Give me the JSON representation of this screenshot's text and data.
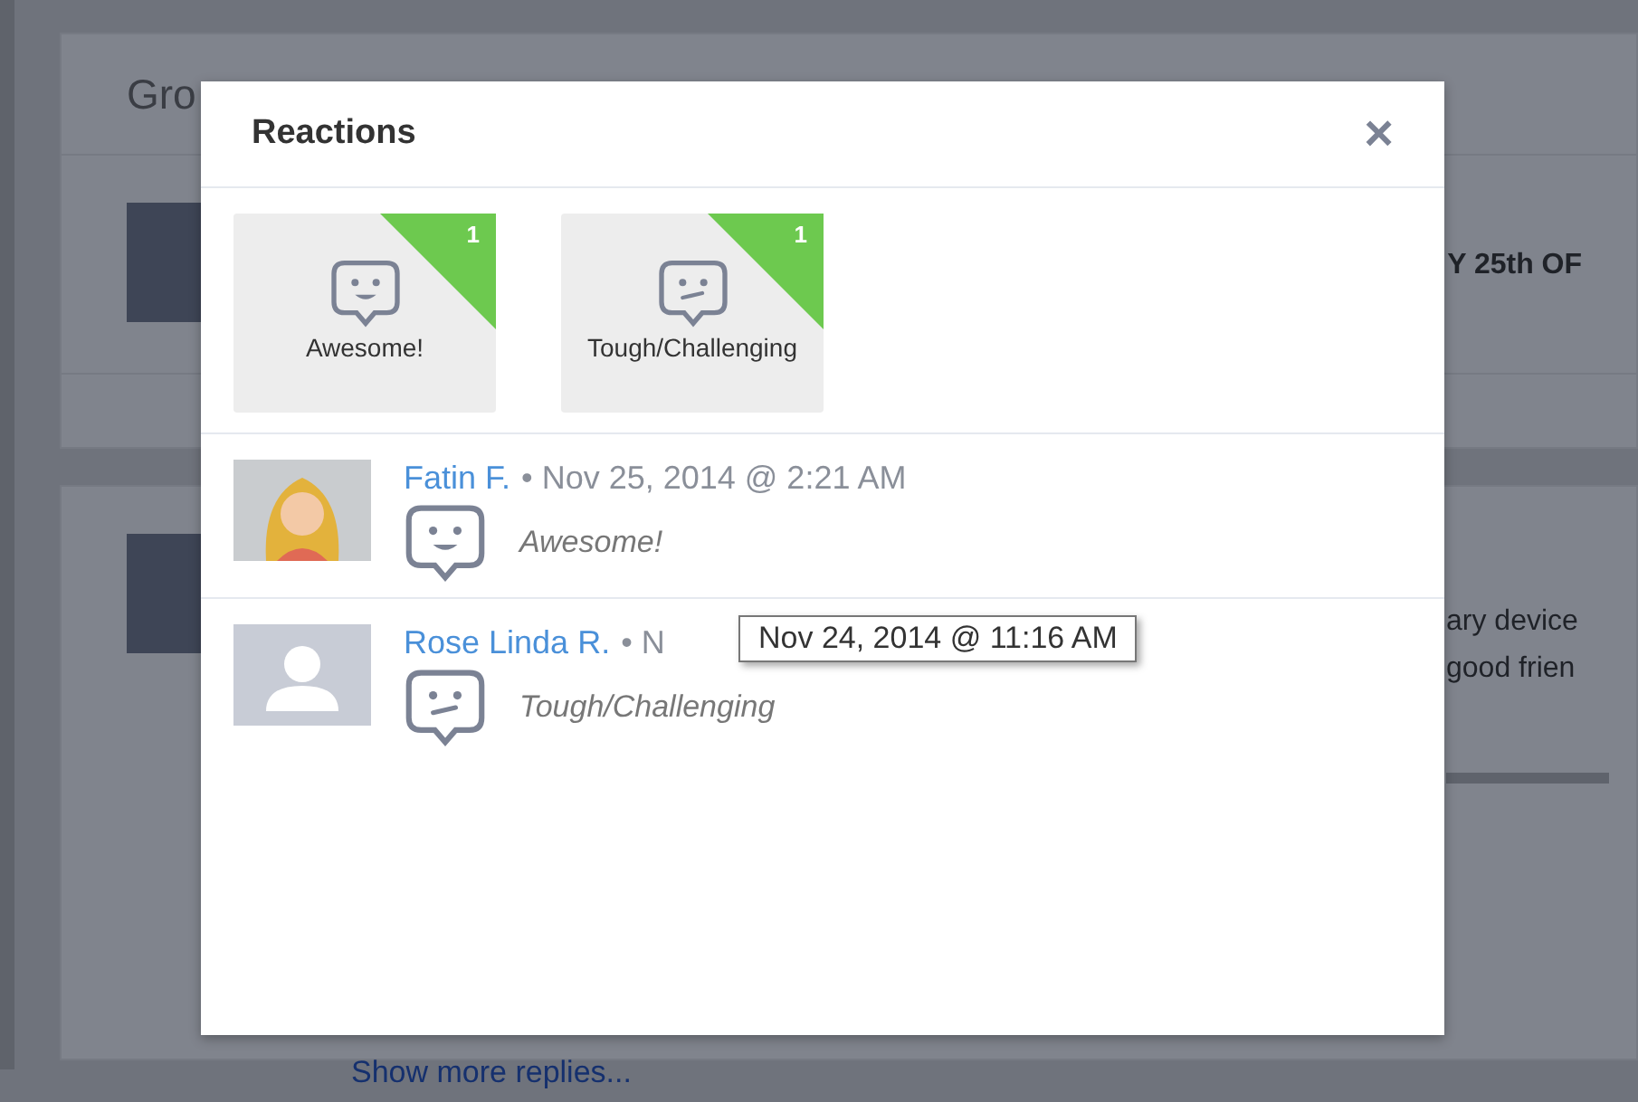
{
  "background": {
    "heading_fragment": "Gro",
    "post_fragment": "Y 25th OF",
    "post_lines": [
      "ary device",
      "good frien"
    ],
    "show_more": "Show more replies..."
  },
  "dialog": {
    "title": "Reactions",
    "close": "×",
    "summary": [
      {
        "kind": "happy",
        "label": "Awesome!",
        "count": "1"
      },
      {
        "kind": "unsure",
        "label": "Tough/Challenging",
        "count": "1"
      }
    ],
    "reactions": [
      {
        "name": "Fatin F.",
        "has_photo": true,
        "separator": "•",
        "date": "Nov 25, 2014 @ 2:21 AM",
        "kind": "happy",
        "reaction": "Awesome!"
      },
      {
        "name": "Rose Linda R.",
        "has_photo": false,
        "separator": "•",
        "date": "N",
        "kind": "unsure",
        "reaction": "Tough/Challenging",
        "tooltip": "Nov 24, 2014 @ 11:16 AM"
      }
    ]
  }
}
